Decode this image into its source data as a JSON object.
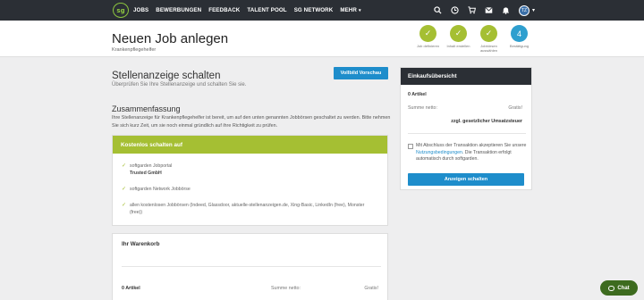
{
  "nav": {
    "logo": "sg",
    "links": [
      "JOBS",
      "BEWERBUNGEN",
      "FEEDBACK",
      "TALENT POOL",
      "SG NETWORK",
      "MEHR"
    ],
    "icons": [
      "search-icon",
      "clock-icon",
      "cart-icon",
      "envelope-icon",
      "bell-icon"
    ],
    "avatar_initials": "TZ",
    "colors": {
      "bar": "#2b2f35",
      "logo": "#8dc63f"
    }
  },
  "header": {
    "title": "Neuen Job anlegen",
    "subtitle": "Krankenpflegehelfer",
    "steps": [
      {
        "label": "Job definieren",
        "state": "done"
      },
      {
        "label": "Inhalt erstellen",
        "state": "done"
      },
      {
        "label": "Jobbörsen auswählen",
        "state": "done"
      },
      {
        "label": "Bestätigung",
        "state": "active",
        "number": "4"
      }
    ],
    "colors": {
      "done": "#a5bf33",
      "active": "#2e9fcf"
    }
  },
  "main": {
    "title": "Stellenanzeige schalten",
    "subtitle": "Überprüfen Sie Ihre Stellenanzeige und schalten Sie sie.",
    "preview_button": "Vollbild Vorschau",
    "summary_title": "Zusammenfassung",
    "summary_text": "Ihre Stellenanzeige für Krankenpflegehelfer ist bereit, um auf den unten genannten Jobbörsen geschaltet zu werden. Bitte nehmen Sie sich kurz Zeit, um sie noch einmal gründlich auf ihre Richtigkeit zu prüfen.",
    "publish": {
      "heading": "Kostenlos schalten auf",
      "items": [
        {
          "line1": "softgarden Jobportal",
          "line2": "Trusted GmbH"
        },
        {
          "line1": "softgarden Network Jobbörse"
        },
        {
          "line1": "allen kostenlosen Jobbörsen (Indeed, Glassdoor, aktuelle-stellenanzeigen.de, Xing-Basic, LinkedIn (free), Monster (free))"
        }
      ]
    },
    "cart": {
      "title": "Ihr Warenkorb",
      "count": "0 Artikel",
      "sum_label": "Summe netto:",
      "sum_value": "Gratis!"
    }
  },
  "sidebar": {
    "heading": "Einkaufsübersicht",
    "count": "0 Artikel",
    "sum_label": "Summe netto:",
    "sum_value": "Gratis!",
    "tax_note": "zzgl. gesetzlicher Umsatzsteuer",
    "terms_prefix": "Mit Abschluss der Transaktion akzeptieren Sie unsere ",
    "terms_link": "Nutzungsbedingungen",
    "terms_suffix": ". Die Transaktion erfolgt automatisch durch softgarden.",
    "checkbox_checked": false,
    "submit_button": "Anzeigen schalten",
    "colors": {
      "button": "#1e8dcb"
    }
  },
  "chat": {
    "label": "Chat",
    "color": "#3d6b1f"
  }
}
